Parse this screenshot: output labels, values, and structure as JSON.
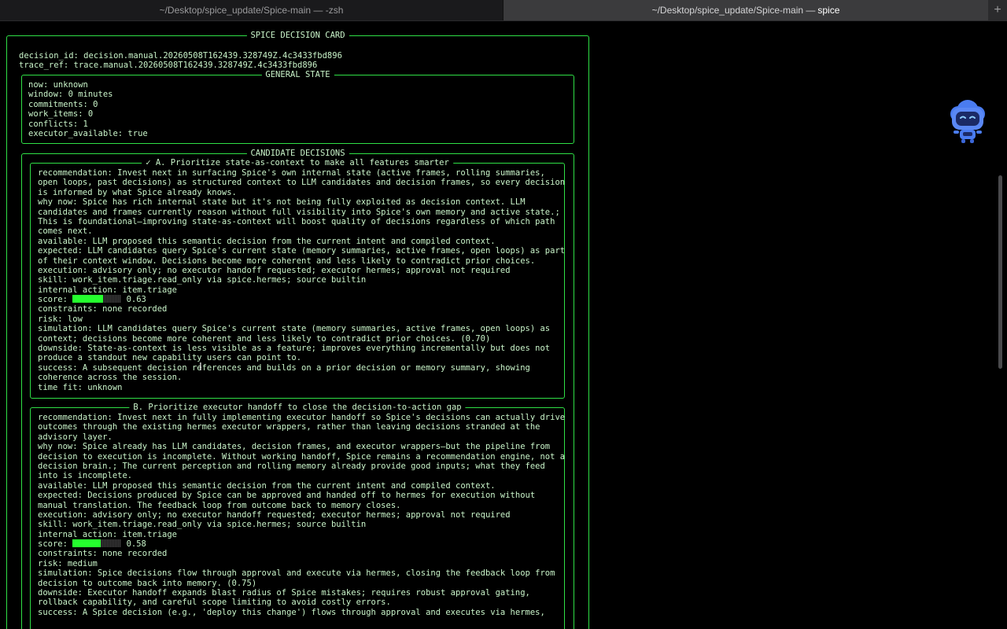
{
  "tabs": [
    {
      "label": "~/Desktop/spice_update/Spice-main — -zsh",
      "active": false
    },
    {
      "label_path": "~/Desktop/spice_update/Spice-main — ",
      "label_cmd": "spice",
      "active": true
    }
  ],
  "tab_add_label": "+",
  "card": {
    "title": "SPICE DECISION CARD",
    "decision_id": "decision_id: decision.manual.20260508T162439.328749Z.4c3433fbd896",
    "trace_ref": "trace_ref: trace.manual.20260508T162439.328749Z.4c3433fbd896"
  },
  "general_state": {
    "title": "GENERAL STATE",
    "lines": [
      "now: unknown",
      "window: 0 minutes",
      "commitments: 0",
      "work_items: 0",
      "conflicts: 1",
      "executor_available: true"
    ]
  },
  "candidates": {
    "title": "CANDIDATE DECISIONS",
    "a": {
      "title": "✓ A. Prioritize state-as-context to make all features smarter",
      "score": 0.63,
      "score_prefix": "score: ",
      "score_label": " 0.63",
      "lines_before_score": [
        "recommendation: Invest next in surfacing Spice's own internal state (active frames, rolling summaries,",
        "open loops, past decisions) as structured context to LLM candidates and decision frames, so every decision",
        "is informed by what Spice already knows.",
        "why now: Spice has rich internal state but it's not being fully exploited as decision context. LLM",
        "candidates and frames currently reason without full visibility into Spice's own memory and active state.;",
        "This is foundational—improving state-as-context will boost quality of decisions regardless of which path",
        "comes next.",
        "available: LLM proposed this semantic decision from the current intent and compiled context.",
        "expected: LLM candidates query Spice's current state (memory summaries, active frames, open loops) as part",
        "of their context window. Decisions become more coherent and less likely to contradict prior choices.",
        "execution: advisory only; no executor handoff requested; executor hermes; approval not required",
        "skill: work_item.triage.read_only via spice.hermes; source builtin",
        "internal action: item.triage"
      ],
      "lines_after_score": [
        "constraints: none recorded",
        "risk: low",
        "simulation: LLM candidates query Spice's current state (memory summaries, active frames, open loops) as",
        "context; decisions become more coherent and less likely to contradict prior choices. (0.70)",
        "downside: State-as-context is less visible as a feature; improves everything incrementally but does not",
        "produce a standout new capability users can point to.",
        "success: A subsequent decision references and builds on a prior decision or memory summary, showing",
        "coherence across the session.",
        "time fit: unknown"
      ]
    },
    "b": {
      "title": "B. Prioritize executor handoff to close the decision-to-action gap",
      "score": 0.58,
      "score_prefix": "score: ",
      "score_label": " 0.58",
      "lines_before_score": [
        "recommendation: Invest next in fully implementing executor handoff so Spice's decisions can actually drive",
        "outcomes through the existing hermes executor wrappers, rather than leaving decisions stranded at the",
        "advisory layer.",
        "why now: Spice already has LLM candidates, decision frames, and executor wrappers—but the pipeline from",
        "decision to execution is incomplete. Without working handoff, Spice remains a recommendation engine, not a",
        "decision brain.; The current perception and rolling memory already provide good inputs; what they feed",
        "into is incomplete.",
        "available: LLM proposed this semantic decision from the current intent and compiled context.",
        "expected: Decisions produced by Spice can be approved and handed off to hermes for execution without",
        "manual translation. The feedback loop from outcome back to memory closes.",
        "execution: advisory only; no executor handoff requested; executor hermes; approval not required",
        "skill: work_item.triage.read_only via spice.hermes; source builtin",
        "internal action: item.triage"
      ],
      "lines_after_score": [
        "constraints: none recorded",
        "risk: medium",
        "simulation: Spice decisions flow through approval and execute via hermes, closing the feedback loop from",
        "decision to outcome back into memory. (0.75)",
        "downside: Executor handoff expands blast radius of Spice mistakes; requires robust approval gating,",
        "rollback capability, and careful scope limiting to avoid costly errors.",
        "success: A Spice decision (e.g., 'deploy this change') flows through approval and executes via hermes,"
      ]
    }
  },
  "colors": {
    "border": "#2fe046",
    "text": "#c9f4c9",
    "score_fill": "#25ff2e",
    "background": "#000000"
  },
  "icons": {
    "mascot": "robot-mascot-icon",
    "cursor": "text-cursor-icon"
  }
}
